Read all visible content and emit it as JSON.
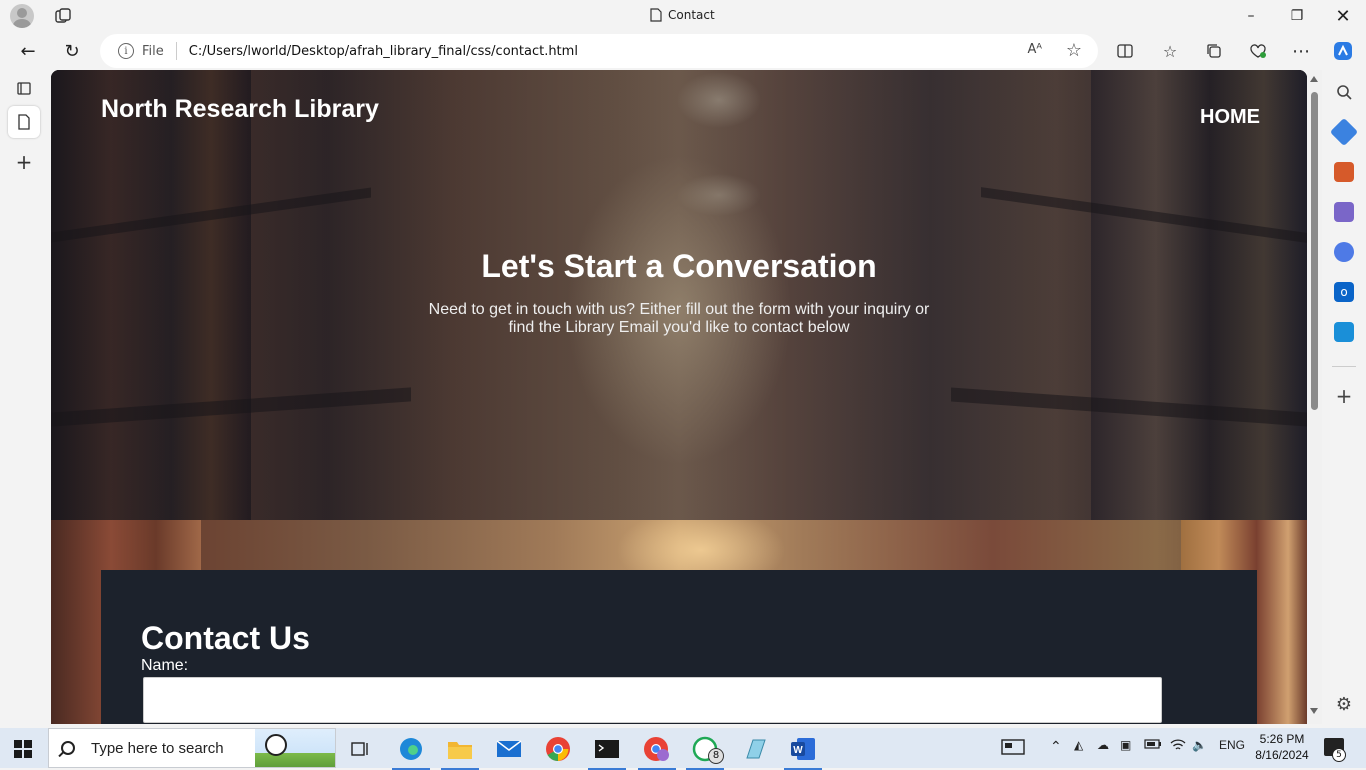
{
  "browser": {
    "tab_title": "Contact",
    "address_prefix": "File",
    "url": "C:/Users/lworld/Desktop/afrah_library_final/css/contact.html",
    "read_aloud_label": "Aᴬ"
  },
  "page": {
    "brand": "North Research Library",
    "nav_home": "HOME",
    "hero_title": "Let's Start a Conversation",
    "hero_subtitle_line1": "Need to get in touch with us? Either fill out the form with your inquiry or",
    "hero_subtitle_line2": "find the Library Email you'd like to contact below",
    "contact_title": "Contact Us",
    "name_label": "Name:"
  },
  "taskbar": {
    "search_placeholder": "Type here to search",
    "language": "ENG",
    "time": "5:26 PM",
    "date": "8/16/2024",
    "whatsapp_badge": "8",
    "notification_count": "5"
  }
}
